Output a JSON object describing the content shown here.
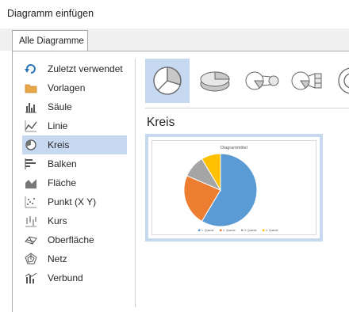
{
  "window": {
    "title": "Diagramm einfügen"
  },
  "tabs": [
    {
      "label": "Alle Diagramme"
    }
  ],
  "categories": [
    {
      "label": "Zuletzt verwendet",
      "icon": "recent-icon"
    },
    {
      "label": "Vorlagen",
      "icon": "folder-icon"
    },
    {
      "label": "Säule",
      "icon": "column-chart-icon"
    },
    {
      "label": "Linie",
      "icon": "line-chart-icon"
    },
    {
      "label": "Kreis",
      "icon": "pie-chart-icon",
      "selected": true
    },
    {
      "label": "Balken",
      "icon": "bar-chart-icon"
    },
    {
      "label": "Fläche",
      "icon": "area-chart-icon"
    },
    {
      "label": "Punkt (X Y)",
      "icon": "scatter-chart-icon"
    },
    {
      "label": "Kurs",
      "icon": "stock-chart-icon"
    },
    {
      "label": "Oberfläche",
      "icon": "surface-chart-icon"
    },
    {
      "label": "Netz",
      "icon": "radar-chart-icon"
    },
    {
      "label": "Verbund",
      "icon": "combo-chart-icon"
    }
  ],
  "subtypes": [
    {
      "icon": "pie-icon",
      "selected": true
    },
    {
      "icon": "3d-pie-icon"
    },
    {
      "icon": "pie-of-pie-icon"
    },
    {
      "icon": "bar-of-pie-icon"
    },
    {
      "icon": "doughnut-icon"
    }
  ],
  "preview": {
    "heading": "Kreis",
    "chart_title": "Diagrammtitel",
    "legend": [
      "1. Quartal",
      "2. Quartal",
      "3. Quartal",
      "4. Quartal"
    ]
  },
  "chart_data": {
    "type": "pie",
    "title": "Diagrammtitel",
    "categories": [
      "1. Quartal",
      "2. Quartal",
      "3. Quartal",
      "4. Quartal"
    ],
    "values": [
      8.2,
      3.2,
      1.4,
      1.2
    ],
    "colors": [
      "#5b9bd5",
      "#ed7d31",
      "#a5a5a5",
      "#ffc000"
    ],
    "legend": "bottom"
  }
}
